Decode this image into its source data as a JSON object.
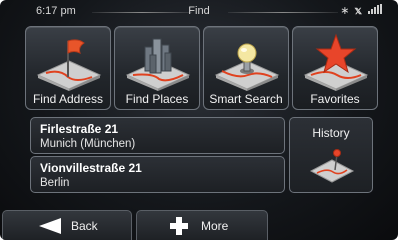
{
  "status": {
    "time": "6:17 pm",
    "title": "Find",
    "icons": [
      "bluetooth-icon",
      "gps-satellite-icon",
      "signal-strength-icon"
    ]
  },
  "tiles": [
    {
      "label": "Find Address",
      "icon": "flag-on-map-icon"
    },
    {
      "label": "Find Places",
      "icon": "city-buildings-icon"
    },
    {
      "label": "Smart Search",
      "icon": "lightbulb-icon"
    },
    {
      "label": "Favorites",
      "icon": "star-icon"
    }
  ],
  "recent": [
    {
      "street": "Firlestraße 21",
      "city": "Munich (München)"
    },
    {
      "street": "Vionvillestraße 21",
      "city": "Berlin"
    }
  ],
  "history": {
    "label": "History",
    "icon": "route-pin-icon"
  },
  "bottom": {
    "back": "Back",
    "more": "More"
  },
  "colors": {
    "background": "#14171b",
    "tile_border": "#6d737b",
    "accent_red": "#e0421f",
    "text": "#ffffff"
  }
}
